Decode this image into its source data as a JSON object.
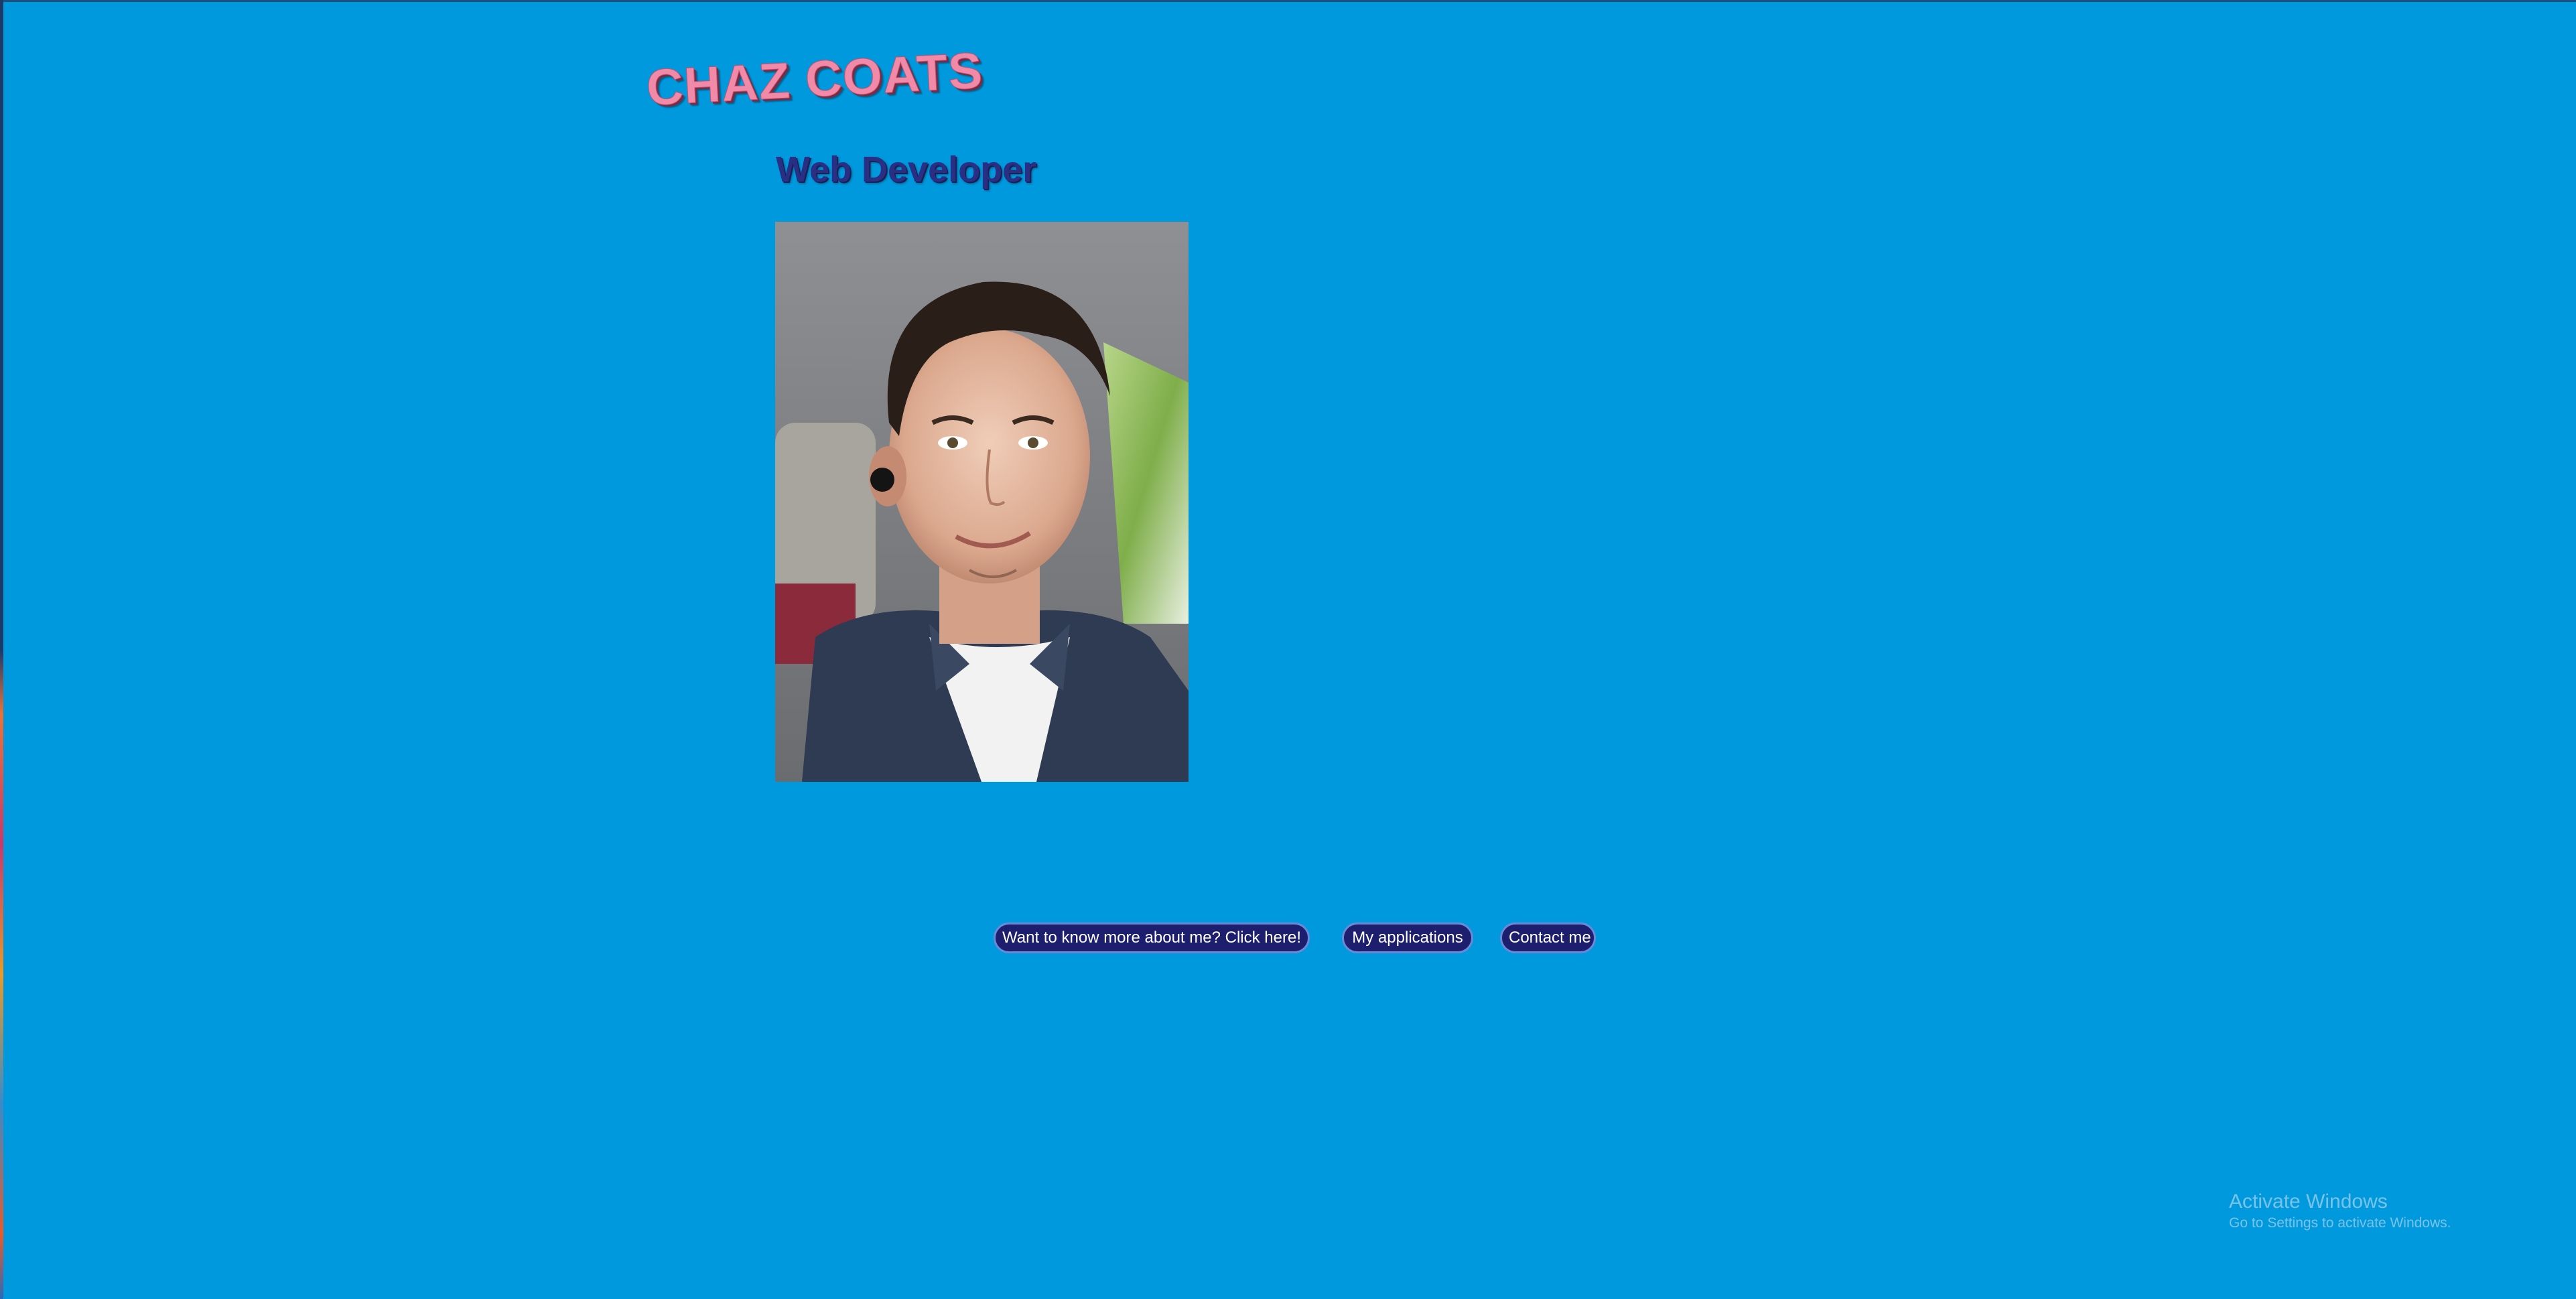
{
  "header": {
    "name": "CHAZ COATS",
    "role": "Web Developer"
  },
  "portrait": {
    "description_icon": "portrait-photo"
  },
  "nav": {
    "about_label": "Want to know more about me? Click here!",
    "applications_label": "My applications",
    "contact_label": "Contact me"
  },
  "watermark": {
    "title": "Activate Windows",
    "subtitle": "Go to Settings to activate Windows."
  },
  "colors": {
    "background": "#0099dd",
    "title_pink": "#f08aa8",
    "subtitle_navy": "#2a2f86",
    "button_bg": "#1e1e6e"
  }
}
